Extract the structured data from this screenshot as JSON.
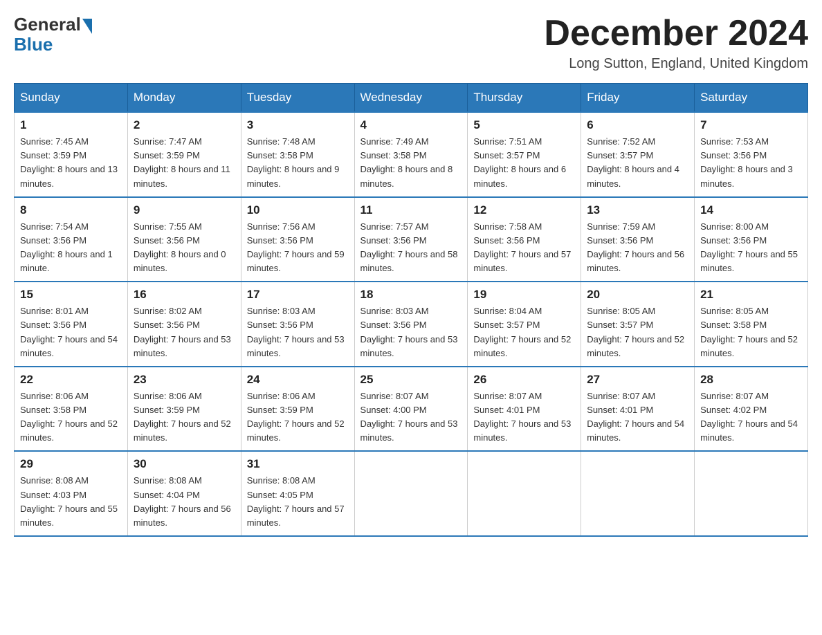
{
  "header": {
    "logo_general": "General",
    "logo_blue": "Blue",
    "month_title": "December 2024",
    "location": "Long Sutton, England, United Kingdom"
  },
  "days_of_week": [
    "Sunday",
    "Monday",
    "Tuesday",
    "Wednesday",
    "Thursday",
    "Friday",
    "Saturday"
  ],
  "weeks": [
    [
      {
        "day": "1",
        "sunrise": "7:45 AM",
        "sunset": "3:59 PM",
        "daylight": "8 hours and 13 minutes."
      },
      {
        "day": "2",
        "sunrise": "7:47 AM",
        "sunset": "3:59 PM",
        "daylight": "8 hours and 11 minutes."
      },
      {
        "day": "3",
        "sunrise": "7:48 AM",
        "sunset": "3:58 PM",
        "daylight": "8 hours and 9 minutes."
      },
      {
        "day": "4",
        "sunrise": "7:49 AM",
        "sunset": "3:58 PM",
        "daylight": "8 hours and 8 minutes."
      },
      {
        "day": "5",
        "sunrise": "7:51 AM",
        "sunset": "3:57 PM",
        "daylight": "8 hours and 6 minutes."
      },
      {
        "day": "6",
        "sunrise": "7:52 AM",
        "sunset": "3:57 PM",
        "daylight": "8 hours and 4 minutes."
      },
      {
        "day": "7",
        "sunrise": "7:53 AM",
        "sunset": "3:56 PM",
        "daylight": "8 hours and 3 minutes."
      }
    ],
    [
      {
        "day": "8",
        "sunrise": "7:54 AM",
        "sunset": "3:56 PM",
        "daylight": "8 hours and 1 minute."
      },
      {
        "day": "9",
        "sunrise": "7:55 AM",
        "sunset": "3:56 PM",
        "daylight": "8 hours and 0 minutes."
      },
      {
        "day": "10",
        "sunrise": "7:56 AM",
        "sunset": "3:56 PM",
        "daylight": "7 hours and 59 minutes."
      },
      {
        "day": "11",
        "sunrise": "7:57 AM",
        "sunset": "3:56 PM",
        "daylight": "7 hours and 58 minutes."
      },
      {
        "day": "12",
        "sunrise": "7:58 AM",
        "sunset": "3:56 PM",
        "daylight": "7 hours and 57 minutes."
      },
      {
        "day": "13",
        "sunrise": "7:59 AM",
        "sunset": "3:56 PM",
        "daylight": "7 hours and 56 minutes."
      },
      {
        "day": "14",
        "sunrise": "8:00 AM",
        "sunset": "3:56 PM",
        "daylight": "7 hours and 55 minutes."
      }
    ],
    [
      {
        "day": "15",
        "sunrise": "8:01 AM",
        "sunset": "3:56 PM",
        "daylight": "7 hours and 54 minutes."
      },
      {
        "day": "16",
        "sunrise": "8:02 AM",
        "sunset": "3:56 PM",
        "daylight": "7 hours and 53 minutes."
      },
      {
        "day": "17",
        "sunrise": "8:03 AM",
        "sunset": "3:56 PM",
        "daylight": "7 hours and 53 minutes."
      },
      {
        "day": "18",
        "sunrise": "8:03 AM",
        "sunset": "3:56 PM",
        "daylight": "7 hours and 53 minutes."
      },
      {
        "day": "19",
        "sunrise": "8:04 AM",
        "sunset": "3:57 PM",
        "daylight": "7 hours and 52 minutes."
      },
      {
        "day": "20",
        "sunrise": "8:05 AM",
        "sunset": "3:57 PM",
        "daylight": "7 hours and 52 minutes."
      },
      {
        "day": "21",
        "sunrise": "8:05 AM",
        "sunset": "3:58 PM",
        "daylight": "7 hours and 52 minutes."
      }
    ],
    [
      {
        "day": "22",
        "sunrise": "8:06 AM",
        "sunset": "3:58 PM",
        "daylight": "7 hours and 52 minutes."
      },
      {
        "day": "23",
        "sunrise": "8:06 AM",
        "sunset": "3:59 PM",
        "daylight": "7 hours and 52 minutes."
      },
      {
        "day": "24",
        "sunrise": "8:06 AM",
        "sunset": "3:59 PM",
        "daylight": "7 hours and 52 minutes."
      },
      {
        "day": "25",
        "sunrise": "8:07 AM",
        "sunset": "4:00 PM",
        "daylight": "7 hours and 53 minutes."
      },
      {
        "day": "26",
        "sunrise": "8:07 AM",
        "sunset": "4:01 PM",
        "daylight": "7 hours and 53 minutes."
      },
      {
        "day": "27",
        "sunrise": "8:07 AM",
        "sunset": "4:01 PM",
        "daylight": "7 hours and 54 minutes."
      },
      {
        "day": "28",
        "sunrise": "8:07 AM",
        "sunset": "4:02 PM",
        "daylight": "7 hours and 54 minutes."
      }
    ],
    [
      {
        "day": "29",
        "sunrise": "8:08 AM",
        "sunset": "4:03 PM",
        "daylight": "7 hours and 55 minutes."
      },
      {
        "day": "30",
        "sunrise": "8:08 AM",
        "sunset": "4:04 PM",
        "daylight": "7 hours and 56 minutes."
      },
      {
        "day": "31",
        "sunrise": "8:08 AM",
        "sunset": "4:05 PM",
        "daylight": "7 hours and 57 minutes."
      },
      null,
      null,
      null,
      null
    ]
  ],
  "labels": {
    "sunrise_prefix": "Sunrise: ",
    "sunset_prefix": "Sunset: ",
    "daylight_prefix": "Daylight: "
  }
}
